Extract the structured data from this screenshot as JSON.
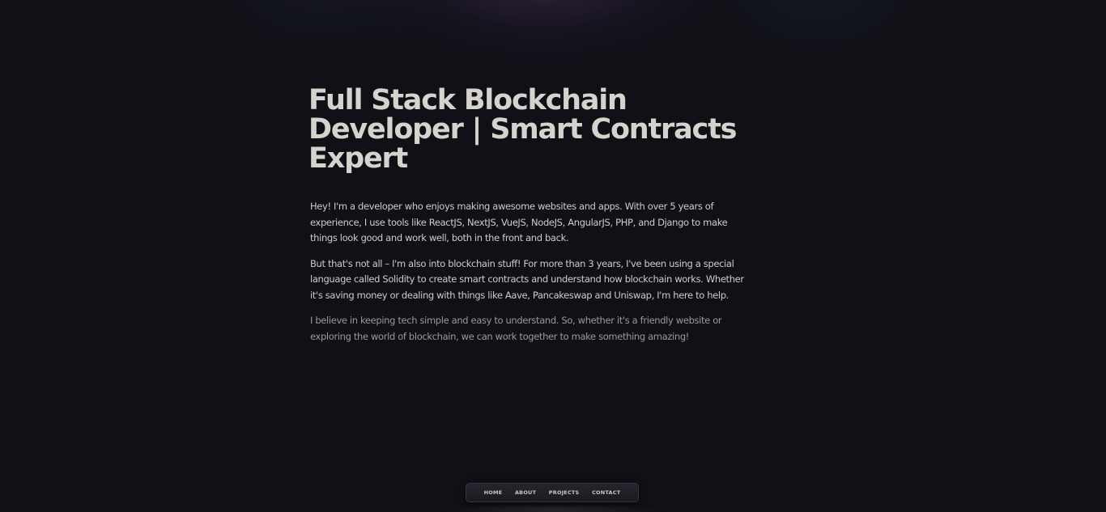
{
  "hero": {
    "title_line1": "Full Stack Blockchain",
    "title_line2": "Developer | Smart Contracts",
    "title_line3": "Expert"
  },
  "bio": {
    "paragraph1": "Hey! I'm a developer who enjoys making awesome websites and apps. With over 5 years of experience, I use tools like ReactJS, NextJS, VueJS, NodeJS, AngularJS, PHP, and Django to make things look good and work well, both in the front and back.",
    "paragraph2": "But that's not all – I'm also into blockchain stuff! For more than 3 years, I've been using a special language called Solidity to create smart contracts and understand how blockchain works. Whether it's saving money or dealing with things like Aave, Pancakeswap and Uniswap, I'm here to help.",
    "paragraph3": "I believe in keeping tech simple and easy to understand. So, whether it's a friendly website or exploring the world of blockchain, we can work together to make something amazing!"
  },
  "nav": {
    "items": [
      {
        "label": "HOME"
      },
      {
        "label": "ABOUT"
      },
      {
        "label": "PROJECTS"
      },
      {
        "label": "CONTACT"
      }
    ]
  },
  "colors": {
    "background": "#101117",
    "heading": "#d6d3ce",
    "body_text": "#cfcdca",
    "dim_text": "#9c9a98",
    "glow_accent": "#583464"
  }
}
